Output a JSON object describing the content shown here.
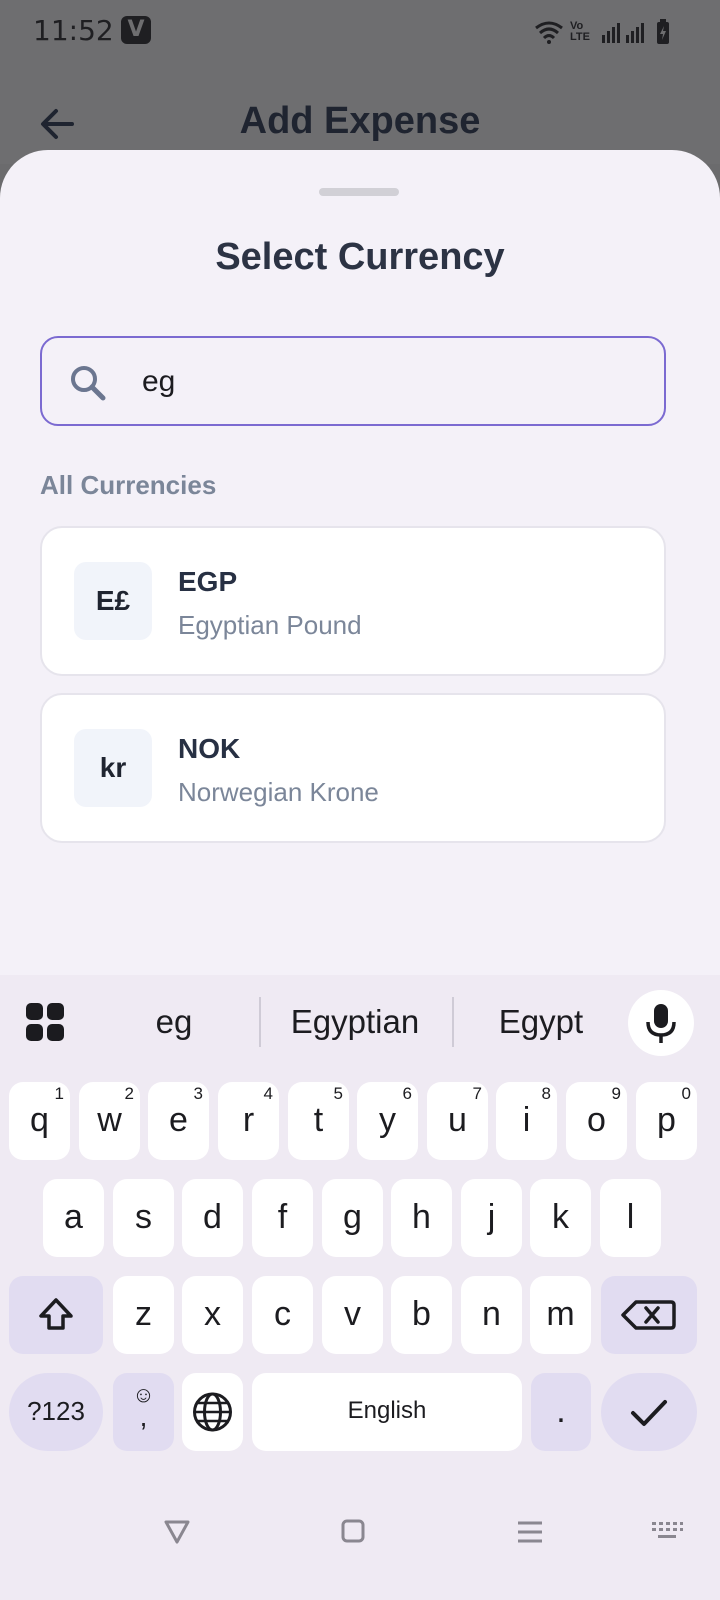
{
  "status_bar": {
    "time": "11:52",
    "badge": "V",
    "volte": "Vo LTE"
  },
  "app_bar": {
    "title": "Add Expense"
  },
  "sheet": {
    "title": "Select Currency",
    "search": {
      "value": "eg"
    },
    "section_label": "All Currencies",
    "currencies": [
      {
        "symbol": "E£",
        "code": "EGP",
        "name": "Egyptian Pound"
      },
      {
        "symbol": "kr",
        "code": "NOK",
        "name": "Norwegian Krone"
      }
    ]
  },
  "keyboard": {
    "suggestions": [
      "eg",
      "Egyptian",
      "Egypt"
    ],
    "row1": [
      {
        "k": "q",
        "n": "1"
      },
      {
        "k": "w",
        "n": "2"
      },
      {
        "k": "e",
        "n": "3"
      },
      {
        "k": "r",
        "n": "4"
      },
      {
        "k": "t",
        "n": "5"
      },
      {
        "k": "y",
        "n": "6"
      },
      {
        "k": "u",
        "n": "7"
      },
      {
        "k": "i",
        "n": "8"
      },
      {
        "k": "o",
        "n": "9"
      },
      {
        "k": "p",
        "n": "0"
      }
    ],
    "row2": [
      "a",
      "s",
      "d",
      "f",
      "g",
      "h",
      "j",
      "k",
      "l"
    ],
    "row3": [
      "z",
      "x",
      "c",
      "v",
      "b",
      "n",
      "m"
    ],
    "symbols_key": "?123",
    "emoji_key": "☺",
    "comma_key": ",",
    "space_label": "English",
    "period_key": "."
  }
}
